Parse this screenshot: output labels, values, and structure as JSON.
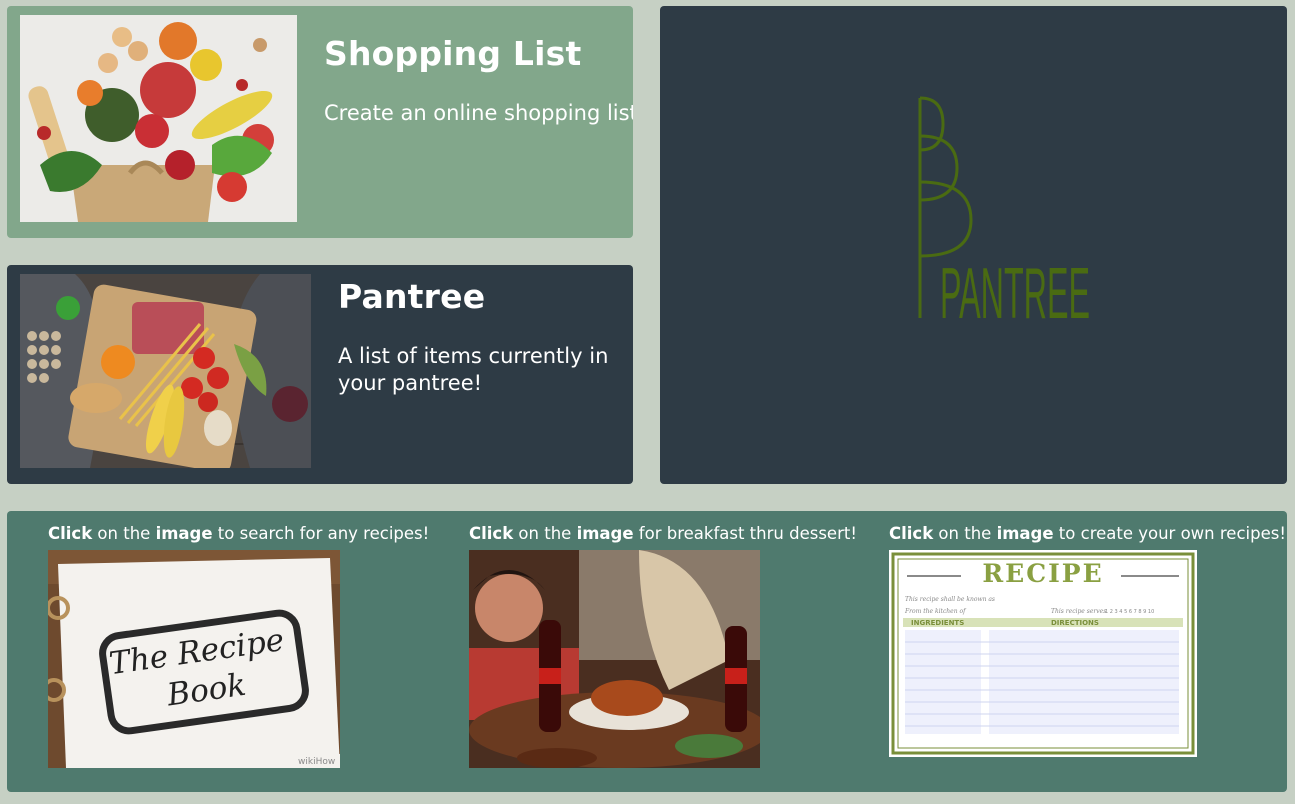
{
  "shopping": {
    "title": "Shopping List",
    "description": "Create an online shopping list!"
  },
  "pantree": {
    "title": "Pantree",
    "description": "A list of items currently in your pantree!"
  },
  "logo": {
    "text": "PANTREE",
    "color": "#4a6b12"
  },
  "recipes": [
    {
      "bold1": "Click",
      "mid": " on the ",
      "bold2": "image",
      "rest": " to search for any recipes!"
    },
    {
      "bold1": "Click",
      "mid": " on the ",
      "bold2": "image",
      "rest": " for breakfast thru dessert!"
    },
    {
      "bold1": "Click",
      "mid": " on the ",
      "bold2": "image",
      "rest": " to create your own recipes!"
    }
  ],
  "recipe_book": {
    "line1": "The Recipe",
    "line2": "Book",
    "watermark": "wikiHow"
  },
  "recipe_card": {
    "heading": "RECIPE",
    "line1": "This recipe shall be known as",
    "line2": "From the kitchen of",
    "serves_label": "This recipe serves",
    "serves": "1 2 3 4 5 6 7 8 9 10",
    "ingredients": "INGREDIENTS",
    "directions": "DIRECTIONS"
  },
  "colors": {
    "background": "#c6d0c4",
    "shopping_card": "#82a78b",
    "dark_card": "#2e3b45",
    "recipes_card": "#4f7a6e"
  }
}
